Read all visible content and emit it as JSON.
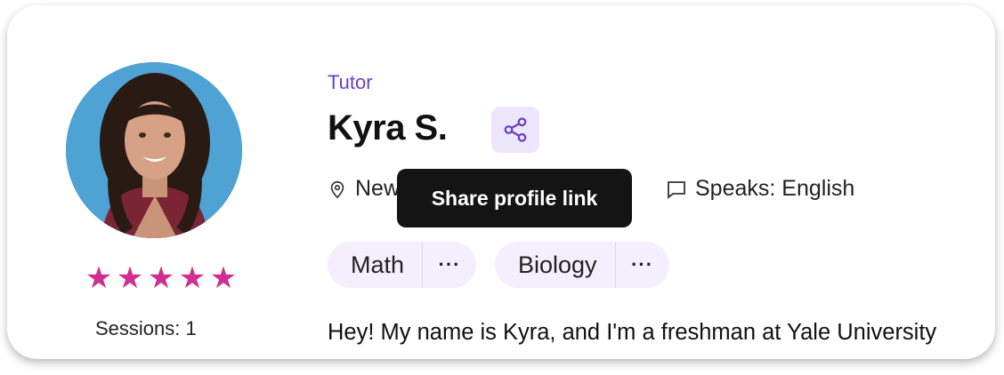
{
  "tutor": {
    "role": "Tutor",
    "name": "Kyra S.",
    "location": "New Haven",
    "speaks": "Speaks: English",
    "rating_stars": 5,
    "sessions": "Sessions: 1",
    "bio": "Hey! My name is Kyra, and I'm a freshman at Yale University"
  },
  "subjects": [
    {
      "label": "Math",
      "more": "···"
    },
    {
      "label": "Biology",
      "more": "···"
    }
  ],
  "share": {
    "tooltip": "Share profile link"
  },
  "colors": {
    "accent": "#6a3fc4",
    "star": "#cf2f8e",
    "share_bg": "#ece6fb",
    "pill_bg": "#f3effc"
  }
}
